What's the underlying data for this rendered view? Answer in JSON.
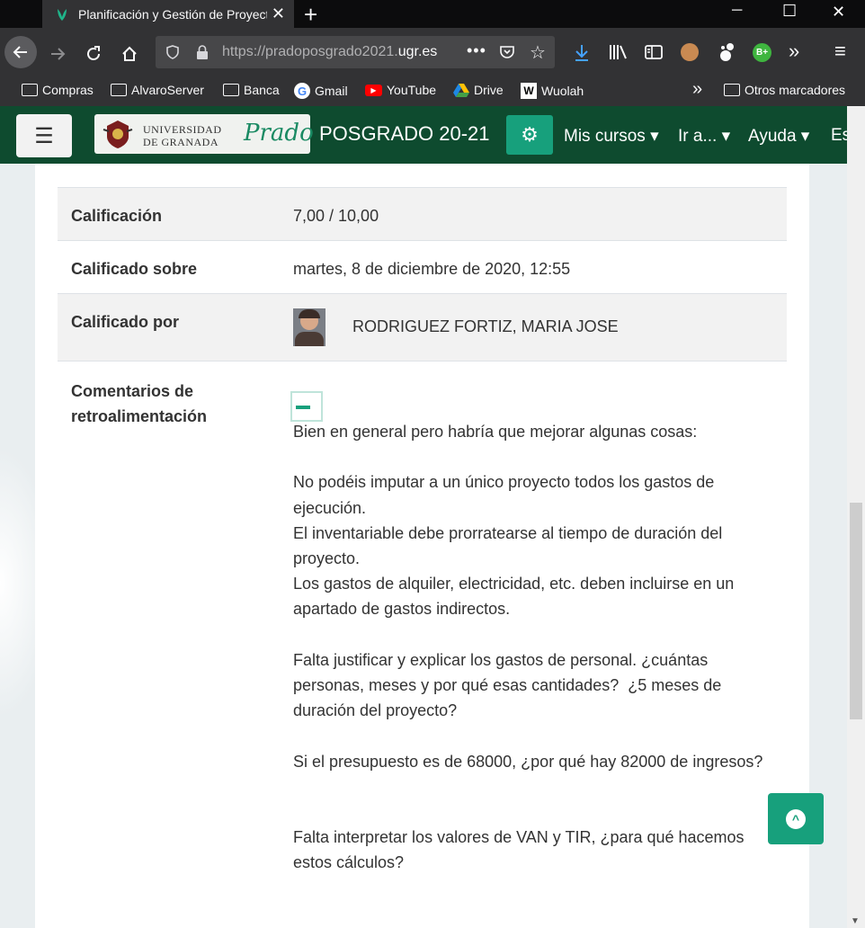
{
  "browser": {
    "tab_title": "Planificación y Gestión de Proyectos",
    "url_prefix": "https://pradoposgrado2021.",
    "url_domain": "ugr.es",
    "bookmarks": [
      "Compras",
      "AlvaroServer",
      "Banca",
      "Gmail",
      "YouTube",
      "Drive",
      "Wuolah"
    ],
    "other_bookmarks": "Otros marcadores"
  },
  "site": {
    "logo_ugr_line1": "UNIVERSIDAD",
    "logo_ugr_line2": "DE GRANADA",
    "logo_prado": "Prado",
    "title": "POSGRADO 20-21",
    "menu": [
      "Mis cursos ▾",
      "Ir a... ▾",
      "Ayuda ▾",
      "Es"
    ]
  },
  "grading": {
    "grade_label": "Calificación",
    "grade_value": "7,00 / 10,00",
    "graded_on_label": "Calificado sobre",
    "graded_on_value": "martes, 8 de diciembre de 2020, 12:55",
    "graded_by_label": "Calificado por",
    "graded_by_value": "RODRIGUEZ FORTIZ, MARIA JOSE",
    "feedback_label_1": "Comentarios de",
    "feedback_label_2": "retroalimentación",
    "feedback_text": "Bien en general pero habría que mejorar algunas cosas:\n\nNo podéis imputar a un único proyecto todos los gastos de ejecución.\nEl inventariable debe prorratearse al tiempo de duración del proyecto.\nLos gastos de alquiler, electricidad, etc. deben incluirse en un apartado de gastos indirectos.\n\nFalta justificar y explicar los gastos de personal. ¿cuántas personas, meses y por qué esas cantidades?  ¿5 meses de duración del proyecto?\n\nSi el presupuesto es de 68000, ¿por qué hay 82000 de ingresos?\n\n\nFalta interpretar los valores de VAN y TIR, ¿para qué hacemos estos cálculos?"
  }
}
